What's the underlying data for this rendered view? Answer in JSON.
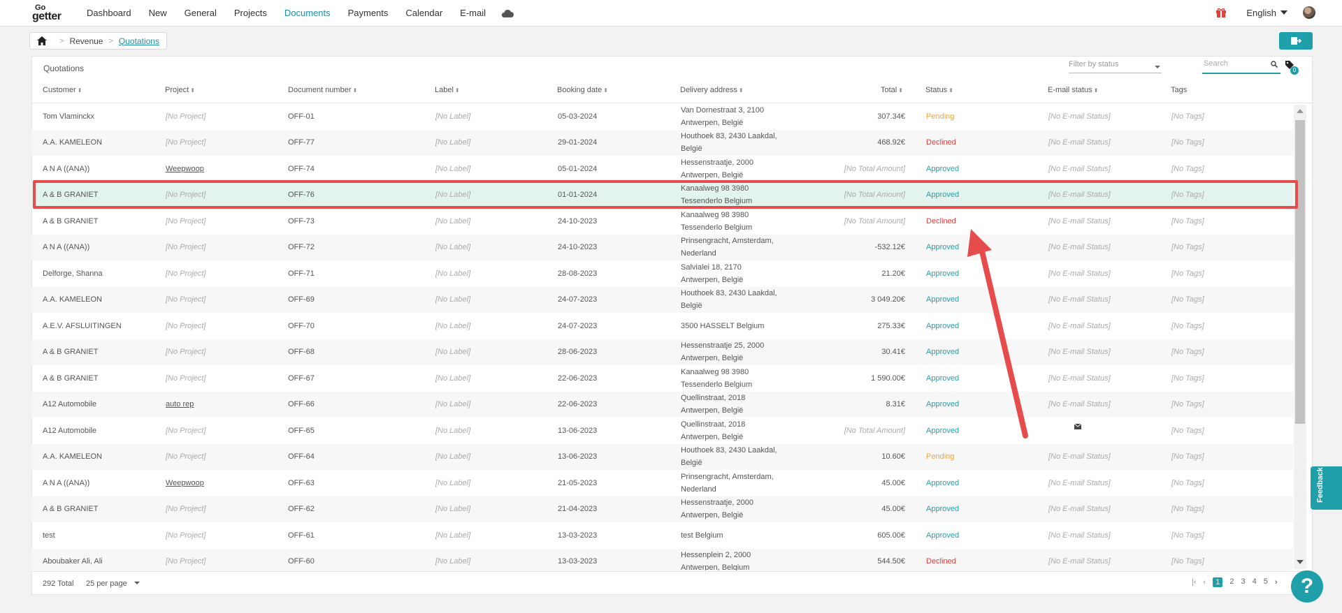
{
  "app": {
    "logo_top": "Go",
    "logo_bottom": "getter"
  },
  "nav": [
    {
      "label": "Dashboard"
    },
    {
      "label": "New"
    },
    {
      "label": "General"
    },
    {
      "label": "Projects"
    },
    {
      "label": "Documents",
      "active": true
    },
    {
      "label": "Payments"
    },
    {
      "label": "Calendar"
    },
    {
      "label": "E-mail"
    }
  ],
  "topbar": {
    "language": "English"
  },
  "breadcrumb": {
    "items": [
      "Revenue",
      "Quotations"
    ]
  },
  "panel": {
    "title": "Quotations",
    "filter_placeholder": "Filter by status",
    "search_placeholder": "Search",
    "tag_count": "0"
  },
  "columns": {
    "customer": "Customer",
    "project": "Project",
    "docnum": "Document number",
    "label": "Label",
    "booking": "Booking date",
    "delivery": "Delivery address",
    "total": "Total",
    "status": "Status",
    "email": "E-mail status",
    "tags": "Tags"
  },
  "rows": [
    {
      "customer": "Tom Vlaminckx",
      "project": "[No Project]",
      "docnum": "OFF-01",
      "label": "[No Label]",
      "date": "05-03-2024",
      "addr1": "Van Dornestraat 3, 2100",
      "addr2": "Antwerpen, België",
      "total": "307.34€",
      "status": "Pending",
      "email": "[No E-mail Status]",
      "tags": "[No Tags]"
    },
    {
      "customer": "A.A. KAMELEON",
      "project": "[No Project]",
      "docnum": "OFF-77",
      "label": "[No Label]",
      "date": "29-01-2024",
      "addr1": "Houthoek 83, 2430 Laakdal,",
      "addr2": "België",
      "total": "468.92€",
      "status": "Declined",
      "email": "[No E-mail Status]",
      "tags": "[No Tags]"
    },
    {
      "customer": "A N A ((ANA))",
      "project": "Weepwoop",
      "docnum": "OFF-74",
      "label": "[No Label]",
      "date": "05-01-2024",
      "addr1": "Hessenstraatje, 2000",
      "addr2": "Antwerpen, België",
      "total": "[No Total Amount]",
      "status": "Approved",
      "email": "[No E-mail Status]",
      "tags": "[No Tags]"
    },
    {
      "customer": "A & B GRANIET",
      "project": "[No Project]",
      "docnum": "OFF-76",
      "label": "[No Label]",
      "date": "01-01-2024",
      "addr1": "Kanaalweg 98 3980",
      "addr2": "Tessenderlo Belgium",
      "total": "[No Total Amount]",
      "status": "Approved",
      "email": "[No E-mail Status]",
      "tags": "[No Tags]"
    },
    {
      "customer": "A & B GRANIET",
      "project": "[No Project]",
      "docnum": "OFF-73",
      "label": "[No Label]",
      "date": "24-10-2023",
      "addr1": "Kanaalweg 98 3980",
      "addr2": "Tessenderlo Belgium",
      "total": "[No Total Amount]",
      "status": "Declined",
      "email": "[No E-mail Status]",
      "tags": "[No Tags]"
    },
    {
      "customer": "A N A ((ANA))",
      "project": "[No Project]",
      "docnum": "OFF-72",
      "label": "[No Label]",
      "date": "24-10-2023",
      "addr1": "Prinsengracht, Amsterdam,",
      "addr2": "Nederland",
      "total": "-532.12€",
      "status": "Approved",
      "email": "[No E-mail Status]",
      "tags": "[No Tags]"
    },
    {
      "customer": "Delforge, Shanna",
      "project": "[No Project]",
      "docnum": "OFF-71",
      "label": "[No Label]",
      "date": "28-08-2023",
      "addr1": "Salvialei 18, 2170",
      "addr2": "Antwerpen, België",
      "total": "21.20€",
      "status": "Approved",
      "email": "[No E-mail Status]",
      "tags": "[No Tags]"
    },
    {
      "customer": "A.A. KAMELEON",
      "project": "[No Project]",
      "docnum": "OFF-69",
      "label": "[No Label]",
      "date": "24-07-2023",
      "addr1": "Houthoek 83, 2430 Laakdal,",
      "addr2": "België",
      "total": "3 049.20€",
      "status": "Approved",
      "email": "[No E-mail Status]",
      "tags": "[No Tags]"
    },
    {
      "customer": "A.E.V. AFSLUITINGEN",
      "project": "[No Project]",
      "docnum": "OFF-70",
      "label": "[No Label]",
      "date": "24-07-2023",
      "addr1": "3500 HASSELT Belgium",
      "addr2": "",
      "total": "275.33€",
      "status": "Approved",
      "email": "[No E-mail Status]",
      "tags": "[No Tags]"
    },
    {
      "customer": "A & B GRANIET",
      "project": "[No Project]",
      "docnum": "OFF-68",
      "label": "[No Label]",
      "date": "28-06-2023",
      "addr1": "Hessenstraatje 25, 2000",
      "addr2": "Antwerpen, België",
      "total": "30.41€",
      "status": "Approved",
      "email": "[No E-mail Status]",
      "tags": "[No Tags]"
    },
    {
      "customer": "A & B GRANIET",
      "project": "[No Project]",
      "docnum": "OFF-67",
      "label": "[No Label]",
      "date": "22-06-2023",
      "addr1": "Kanaalweg 98 3980",
      "addr2": "Tessenderlo Belgium",
      "total": "1 590.00€",
      "status": "Approved",
      "email": "[No E-mail Status]",
      "tags": "[No Tags]"
    },
    {
      "customer": "A12 Automobile",
      "project": "auto rep",
      "docnum": "OFF-66",
      "label": "[No Label]",
      "date": "22-06-2023",
      "addr1": "Quellinstraat, 2018",
      "addr2": "Antwerpen, België",
      "total": "8.31€",
      "status": "Approved",
      "email": "[No E-mail Status]",
      "tags": "[No Tags]"
    },
    {
      "customer": "A12 Automobile",
      "project": "[No Project]",
      "docnum": "OFF-65",
      "label": "[No Label]",
      "date": "13-06-2023",
      "addr1": "Quellinstraat, 2018",
      "addr2": "Antwerpen, België",
      "total": "[No Total Amount]",
      "status": "Approved",
      "email": "",
      "email_icon": "envelope-icon",
      "tags": "[No Tags]"
    },
    {
      "customer": "A.A. KAMELEON",
      "project": "[No Project]",
      "docnum": "OFF-64",
      "label": "[No Label]",
      "date": "13-06-2023",
      "addr1": "Houthoek 83, 2430 Laakdal,",
      "addr2": "België",
      "total": "10.60€",
      "status": "Pending",
      "email": "[No E-mail Status]",
      "tags": "[No Tags]"
    },
    {
      "customer": "A N A ((ANA))",
      "project": "Weepwoop",
      "docnum": "OFF-63",
      "label": "[No Label]",
      "date": "21-05-2023",
      "addr1": "Prinsengracht, Amsterdam,",
      "addr2": "Nederland",
      "total": "45.00€",
      "status": "Approved",
      "email": "[No E-mail Status]",
      "tags": "[No Tags]"
    },
    {
      "customer": "A & B GRANIET",
      "project": "[No Project]",
      "docnum": "OFF-62",
      "label": "[No Label]",
      "date": "21-04-2023",
      "addr1": "Hessenstraatje, 2000",
      "addr2": "Antwerpen, België",
      "total": "45.00€",
      "status": "Approved",
      "email": "[No E-mail Status]",
      "tags": "[No Tags]"
    },
    {
      "customer": "test",
      "project": "[No Project]",
      "docnum": "OFF-61",
      "label": "[No Label]",
      "date": "13-03-2023",
      "addr1": "test Belgium",
      "addr2": "",
      "total": "605.00€",
      "status": "Approved",
      "email": "[No E-mail Status]",
      "tags": "[No Tags]"
    },
    {
      "customer": "Aboubaker Ali, Ali",
      "project": "[No Project]",
      "docnum": "OFF-60",
      "label": "[No Label]",
      "date": "13-03-2023",
      "addr1": "Hessenplein 2, 2000",
      "addr2": "Antwerpen, Belgium",
      "total": "544.50€",
      "status": "Declined",
      "email": "[No E-mail Status]",
      "tags": "[No Tags]"
    }
  ],
  "footer": {
    "total": "292 Total",
    "per_page": "25 per page",
    "pages": [
      "1",
      "2",
      "3",
      "4",
      "5"
    ],
    "current_page": "1"
  },
  "feedback": {
    "label": "Feedback"
  },
  "help": {
    "label": "?"
  },
  "colors": {
    "accent": "#1f9faa",
    "pending": "#f0a23c",
    "declined": "#e0413b",
    "approved": "#1f9faa",
    "annotation": "#e74c4c"
  }
}
